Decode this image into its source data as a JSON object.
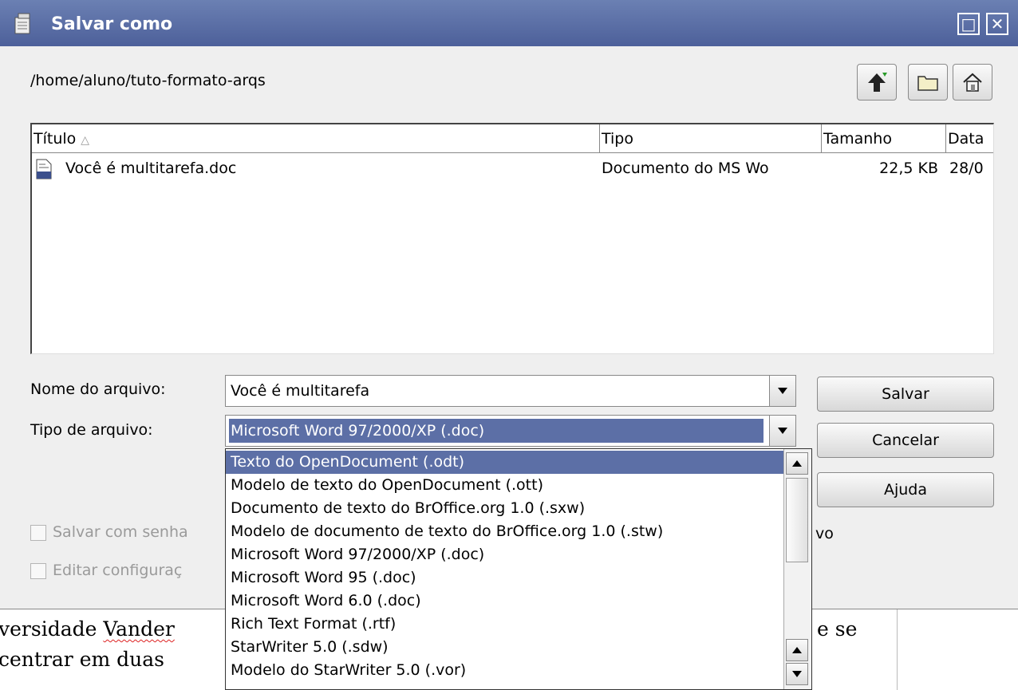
{
  "window": {
    "title": "Salvar como"
  },
  "toolbar": {
    "path": "/home/aluno/tuto-formato-arqs"
  },
  "filelist": {
    "columns": [
      {
        "label": "Título"
      },
      {
        "label": "Tipo"
      },
      {
        "label": "Tamanho"
      },
      {
        "label": "Data"
      }
    ],
    "rows": [
      {
        "name": "Você é multitarefa.doc",
        "type": "Documento do MS Wo",
        "size": "22,5 KB",
        "date": "28/0"
      }
    ]
  },
  "form": {
    "filename_label": "Nome do arquivo:",
    "filename_value": "Você é multitarefa",
    "filetype_label": "Tipo de arquivo:",
    "filetype_value": "Microsoft Word 97/2000/XP (.doc)"
  },
  "buttons": {
    "save": "Salvar",
    "cancel": "Cancelar",
    "help": "Ajuda"
  },
  "checkboxes": [
    {
      "label": "Salvar com senha",
      "tail": "vo"
    },
    {
      "label": "Editar configuraç"
    }
  ],
  "dropdown": {
    "items": [
      "Texto do OpenDocument (.odt)",
      "Modelo de texto do OpenDocument (.ott)",
      "Documento de texto do BrOffice.org 1.0 (.sxw)",
      "Modelo de documento de texto do BrOffice.org 1.0 (.stw)",
      "Microsoft Word 97/2000/XP (.doc)",
      "Microsoft Word 95 (.doc)",
      "Microsoft Word 6.0 (.doc)",
      "Rich Text Format (.rtf)",
      "StarWriter 5.0 (.sdw)",
      "Modelo do StarWriter 5.0 (.vor)"
    ],
    "selected_index": 0
  },
  "background": {
    "line1_prefix": "versidade ",
    "line1_misspelled": "Vander",
    "line2": "centrar em duas",
    "right_text": "e se"
  },
  "colors": {
    "titlebar": "#5c6fa6",
    "selection": "#5c6fa6"
  }
}
